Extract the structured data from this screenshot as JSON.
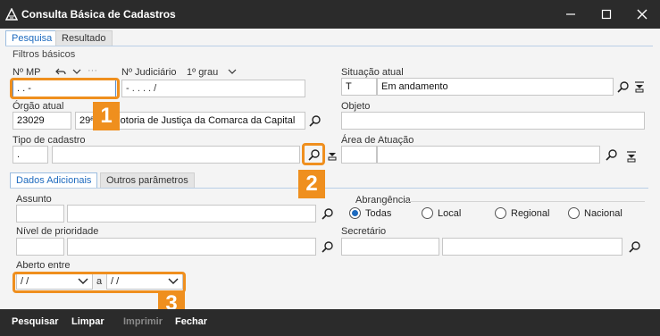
{
  "window": {
    "title": "Consulta Básica de Cadastros"
  },
  "tabs": {
    "pesquisa": "Pesquisa",
    "resultado": "Resultado"
  },
  "filtros": {
    "title": "Filtros básicos",
    "nr_mp_label": "Nº MP",
    "nr_mp_value": ".  .      -",
    "nr_judiciario_label": "Nº Judiciário",
    "grau_value": "1º grau",
    "nr_judiciario_value": "-  .  .  .  .  /",
    "situacao_label": "Situação atual",
    "situacao_code": "T",
    "situacao_desc": "Em andamento",
    "orgao_label": "Órgão atual",
    "orgao_code": "23029",
    "orgao_desc": "29ª Promotoria de Justiça da Comarca da Capital",
    "objeto_label": "Objeto",
    "objeto_value": "",
    "tipo_label": "Tipo de cadastro",
    "tipo_code": ".",
    "tipo_desc": "",
    "area_label": "Área de Atuação",
    "area_code": "",
    "area_desc": ""
  },
  "subtabs": {
    "dados": "Dados Adicionais",
    "outros": "Outros parâmetros"
  },
  "adicionais": {
    "assunto_label": "Assunto",
    "abrangencia_label": "Abrangência",
    "abrangencia_options": [
      "Todas",
      "Local",
      "Regional",
      "Nacional"
    ],
    "abrangencia_selected": "Todas",
    "prioridade_label": "Nível de prioridade",
    "secretario_label": "Secretário",
    "aberto_label": "Aberto entre",
    "data_inicio": "/ /",
    "data_sep": "a",
    "data_fim": "/ /"
  },
  "callouts": [
    "1",
    "2",
    "3"
  ],
  "footer": {
    "pesquisar": "Pesquisar",
    "limpar": "Limpar",
    "imprimir": "Imprimir",
    "fechar": "Fechar"
  },
  "colors": {
    "accent": "#ef8f1e",
    "titlebar": "#2b2b2b",
    "tab_active": "#1e6bbf"
  }
}
